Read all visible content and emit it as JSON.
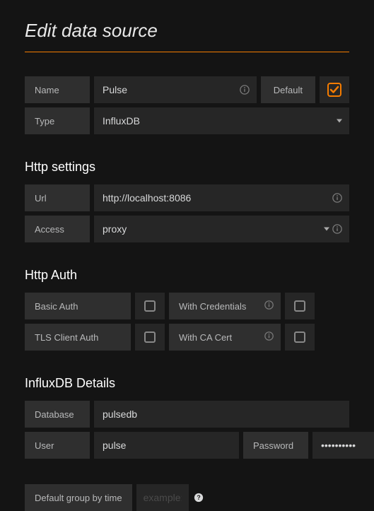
{
  "title": "Edit data source",
  "name": {
    "label": "Name",
    "value": "Pulse"
  },
  "default": {
    "label": "Default",
    "checked": true
  },
  "type": {
    "label": "Type",
    "value": "InfluxDB"
  },
  "http_settings": {
    "title": "Http settings",
    "url": {
      "label": "Url",
      "value": "http://localhost:8086"
    },
    "access": {
      "label": "Access",
      "value": "proxy"
    }
  },
  "http_auth": {
    "title": "Http Auth",
    "basic": {
      "label": "Basic Auth",
      "checked": false
    },
    "with_credentials": {
      "label": "With Credentials",
      "checked": false
    },
    "tls": {
      "label": "TLS Client Auth",
      "checked": false
    },
    "ca_cert": {
      "label": "With CA Cert",
      "checked": false
    }
  },
  "influx": {
    "title": "InfluxDB Details",
    "database": {
      "label": "Database",
      "value": "pulsedb"
    },
    "user": {
      "label": "User",
      "value": "pulse"
    },
    "password": {
      "label": "Password",
      "value": "••••••••••"
    }
  },
  "group_by": {
    "label": "Default group by time",
    "placeholder": "example:",
    "value": ""
  }
}
